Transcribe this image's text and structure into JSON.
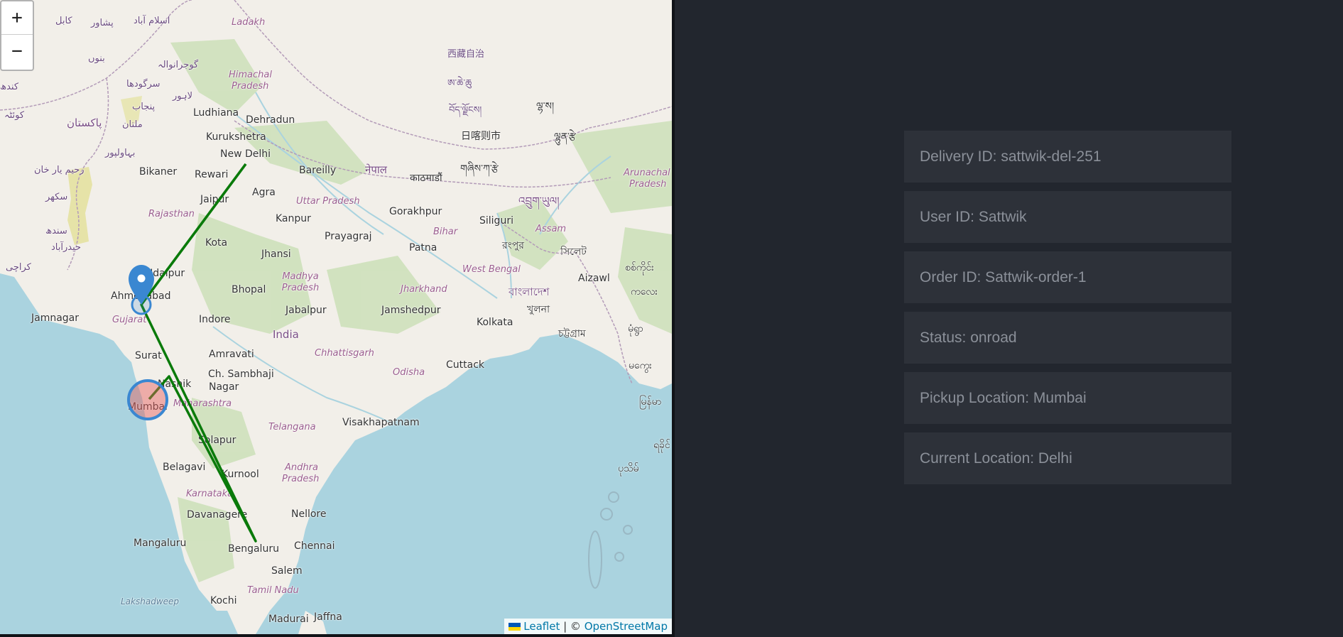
{
  "map": {
    "zoom_in_label": "+",
    "zoom_out_label": "−",
    "attribution": {
      "leaflet_label": "Leaflet",
      "separator": " | © ",
      "osm_label": "OpenStreetMap"
    },
    "route_color": "#0a7a0a",
    "marker_color": "#3a87d1",
    "labels": {
      "new_delhi": "New Delhi",
      "dehradun": "Dehradun",
      "ludhiana": "Ludhiana",
      "kurukshetra": "Kurukshetra",
      "bareilly": "Bareilly",
      "agra": "Agra",
      "jaipur": "Jaipur",
      "bikaner": "Bikaner",
      "rewari": "Rewari",
      "rajasthan": "Rajasthan",
      "kota": "Kota",
      "kanpur": "Kanpur",
      "uttar_pradesh": "Uttar Pradesh",
      "gorakhpur": "Gorakhpur",
      "prayagraj": "Prayagraj",
      "jhansi": "Jhansi",
      "bihar": "Bihar",
      "patna": "Patna",
      "siliguri": "Siliguri",
      "assam": "Assam",
      "west_bengal": "West Bengal",
      "jharkhand": "Jharkhand",
      "madhya_pradesh": "Madhya Pradesh",
      "bhopal": "Bhopal",
      "jabalpur": "Jabalpur",
      "jamshedpur": "Jamshedpur",
      "kolkata": "Kolkata",
      "india": "India",
      "indore": "Indore",
      "ahmedabad": "Ahmedabad",
      "udaipur": "Udaipur",
      "jamnagar": "Jamnagar",
      "gujarat": "Gujarat",
      "surat": "Surat",
      "amravati": "Amravati",
      "chhattisgarh": "Chhattisgarh",
      "odisha": "Odisha",
      "cuttack": "Cuttack",
      "ch_sambhaji": "Ch. Sambhaji",
      "nagar": "Nagar",
      "nashik": "Nashik",
      "maharashtra": "Maharashtra",
      "mumbai": "Mumbai",
      "telangana": "Telangana",
      "visakhapatnam": "Visakhapatnam",
      "solapur": "Solapur",
      "belagavi": "Belagavi",
      "kurnool": "Kurnool",
      "andhra_pradesh_1": "Andhra",
      "andhra_pradesh_2": "Pradesh",
      "karnataka": "Karnataka",
      "davanagere": "Davanagere",
      "nellore": "Nellore",
      "mangaluru": "Mangaluru",
      "bengaluru": "Bengaluru",
      "chennai": "Chennai",
      "salem": "Salem",
      "lakshadweep": "Lakshadweep",
      "tamil_nadu": "Tamil Nadu",
      "kochi": "Kochi",
      "madurai": "Madurai",
      "jaffna": "Jaffna",
      "aizawl": "Aizawl",
      "arunachal_1": "Arunachal",
      "arunachal_2": "Pradesh",
      "ladakh": "Ladakh",
      "himachal_1": "Himachal",
      "himachal_2": "Pradesh",
      "tibet": "西藏自治",
      "pakistan": "پاکستان",
      "multan": "ملتان",
      "bahawalpur": "بہاولپور",
      "rahim_yar_khan": "رحیم یار خان",
      "sukkur": "سکھر",
      "sindh": "سندھ",
      "hyderabad_pk": "حیدرآباد",
      "karachi": "کراچی",
      "islamabad": "اسلام آباد",
      "peshawar": "پشاور",
      "kabul": "کابل",
      "bannu": "بنوں",
      "gujranwala": "گوجرانوالہ",
      "sargodha": "سرگودھا",
      "punjab_pk": "پنجاب",
      "lahore": "لاہور",
      "quetta": "کوئٹہ",
      "kandahar": "کندھ",
      "nepal": "नेपाल",
      "kathmandu": "काठमाडौं",
      "bangladesh": "বাংলাদেশ",
      "khulna": "খুলনা",
      "rangpur": "রংপুর",
      "sylhet": "সিলেট",
      "chattogram": "চট্টগ্রাম",
      "bhutan": "འབྲུག་ཡུལ།",
      "lhasa": "ལྷ་ས།",
      "tibet_2": "བོད་ལྗོངས།",
      "rikaze": "日喀则市",
      "shigatse": "གཞིས་ཀ་རྩེ",
      "tibet_3": "ཨ་ཆེ་ཆུ",
      "myanmar_1": "မြန်မာ",
      "myanmar_2": "ကလေး",
      "myanmar_3": "မုံရွာ",
      "myanmar_4": "မကွေး",
      "myanmar_5": "စစ်ကိုင်း",
      "myanmar_6": "ရခိုင်",
      "myanmar_7": "ပုသိမ်",
      "lhunze": "ལྷུན་རྩེ",
      "nyingchi": "ཉིང་ཁྲི"
    }
  },
  "details": {
    "delivery_id": "Delivery ID: sattwik-del-251",
    "user_id": "User ID: Sattwik",
    "order_id": "Order ID: Sattwik-order-1",
    "status": "Status: onroad",
    "pickup_location": "Pickup Location: Mumbai",
    "current_location": "Current Location: Delhi"
  }
}
